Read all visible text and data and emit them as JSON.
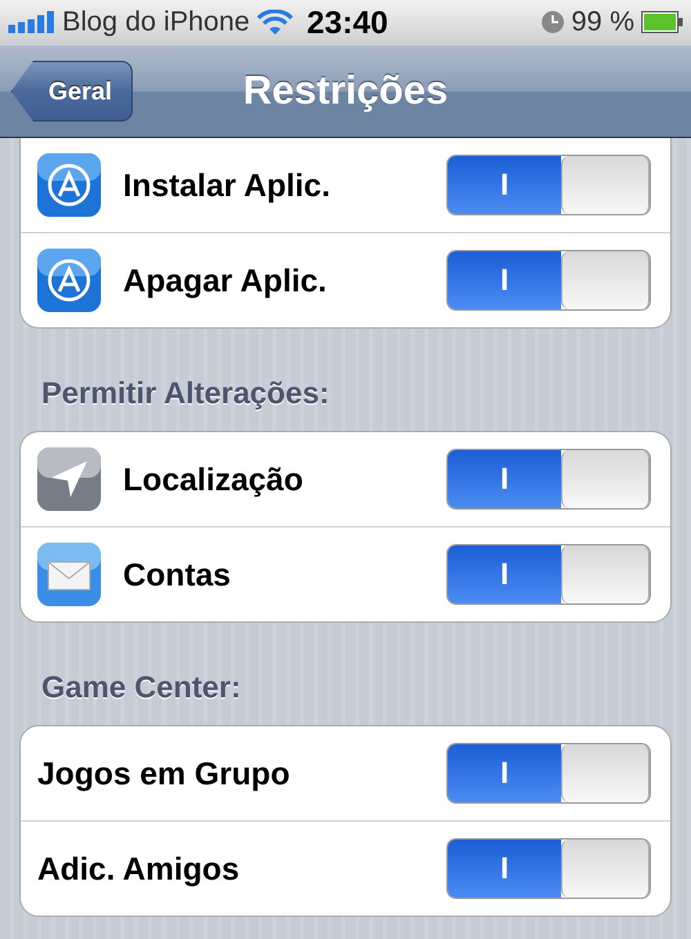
{
  "status_bar": {
    "carrier": "Blog do iPhone",
    "time": "23:40",
    "battery": "99 %"
  },
  "nav_bar": {
    "back": "Geral",
    "title": "Restrições"
  },
  "groups": [
    {
      "rows": [
        {
          "label": "Instalar Aplic.",
          "kind": "app-store",
          "switch_label": "I",
          "on": true
        },
        {
          "label": "Apagar Aplic.",
          "kind": "app-store",
          "switch_label": "I",
          "on": true
        }
      ]
    },
    {
      "header": "Permitir Alterações:",
      "rows": [
        {
          "label": "Localização",
          "kind": "location",
          "switch_label": "I",
          "on": true
        },
        {
          "label": "Contas",
          "kind": "mail",
          "switch_label": "I",
          "on": true
        }
      ]
    },
    {
      "header": "Game Center:",
      "rows": [
        {
          "label": "Jogos em Grupo",
          "kind": "plain",
          "switch_label": "I",
          "on": true
        },
        {
          "label": "Adic. Amigos",
          "kind": "plain",
          "switch_label": "I",
          "on": true
        }
      ]
    }
  ]
}
